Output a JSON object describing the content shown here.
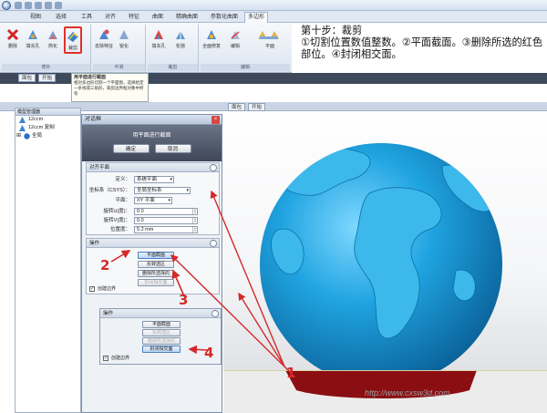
{
  "ribbon": {
    "tabs": [
      "视图",
      "选择",
      "工具",
      "对齐",
      "特征",
      "曲面",
      "精确曲面",
      "参数化曲面",
      "多边形"
    ],
    "active_tab_index": 8,
    "buttons": [
      "删除",
      "填充孔",
      "简化",
      "裁剪",
      "去除特征",
      "填充孔",
      "锐化",
      "松弛",
      "全面修复",
      "编辑",
      "平面"
    ],
    "groups": [
      "修补",
      "平滑",
      "裁剪",
      "编辑"
    ]
  },
  "instruction": {
    "line1": "第十步：裁剪",
    "line2": "①切割位置数值整数。②平面截面。③删除所选的红色部位。④封闭相交面。"
  },
  "tooltip": {
    "title": "用平面进行截面",
    "body": "相对多边形切割一个平面图，选择给定一条线或三角形，裁剪边界框对象中所有"
  },
  "doc_tabs": [
    "面包",
    "开始"
  ],
  "tree": {
    "header": "模型管理器",
    "items": [
      "12ccm",
      "12ccm 复制",
      "全局"
    ]
  },
  "dialog": {
    "title": "对话框",
    "banner": "用平面进行截面",
    "ok": "确定",
    "cancel": "取消",
    "align_section": "对齐平面",
    "fields": {
      "define_label": "定义：",
      "define_value": "系统平面",
      "coord_label": "坐标系（CSYS）：",
      "coord_value": "全局坐标系",
      "plane_label": "平面：",
      "plane_value": "XY 平面",
      "rot1_label": "旋转U(度)：",
      "rot1_value": "0.0",
      "rot2_label": "旋转V(度)：",
      "rot2_value": "0.0",
      "pos_label": "位置度：",
      "pos_value": "5.2 mm"
    },
    "ops_section": "操作",
    "ops": {
      "section_plane": "平面截面",
      "reverse": "反转选区",
      "delete_selected": "删除所选择的",
      "close_intersection": "封闭相交面"
    },
    "create_boundary": "创建边界"
  },
  "inset": {
    "section": "操作",
    "ops": [
      "平面截面",
      "反转选区",
      "删除所选择的",
      "封闭相交面"
    ],
    "create_boundary": "创建边界"
  },
  "annotations": [
    "1",
    "2",
    "3",
    "4"
  ],
  "colors": {
    "annotation_red": "#d22a2a",
    "globe_blue": "#1f9fd8",
    "cut_red": "#8b0f12"
  },
  "watermark": "http://www.cxsw3d.com"
}
